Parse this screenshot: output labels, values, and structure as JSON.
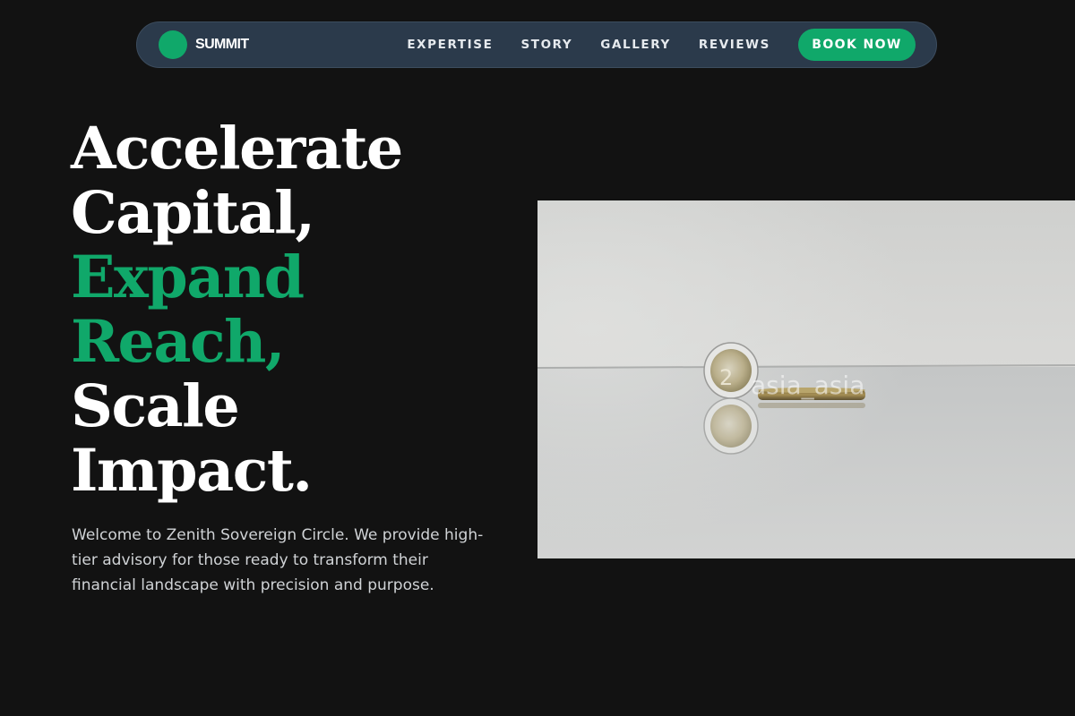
{
  "nav": {
    "brand": "SUMMIT",
    "links": [
      "EXPERTISE",
      "STORY",
      "GALLERY",
      "REVIEWS"
    ],
    "cta_label": "BOOK NOW"
  },
  "hero": {
    "headline_lines": [
      "Accelerate",
      "Capital,",
      "Expand",
      "Reach,",
      "Scale",
      "Impact."
    ],
    "description": "Welcome to Zenith Sovereign Circle. We provide high-tier advisory for those ready to transform their financial landscape with precision and purpose."
  },
  "photo": {
    "watermark": "asia_asia"
  },
  "colors": {
    "background": "#121212",
    "nav_background": "#2b3a4b",
    "accent": "#10a86a",
    "text": "#ffffff",
    "muted_text": "#d0d3d6"
  }
}
